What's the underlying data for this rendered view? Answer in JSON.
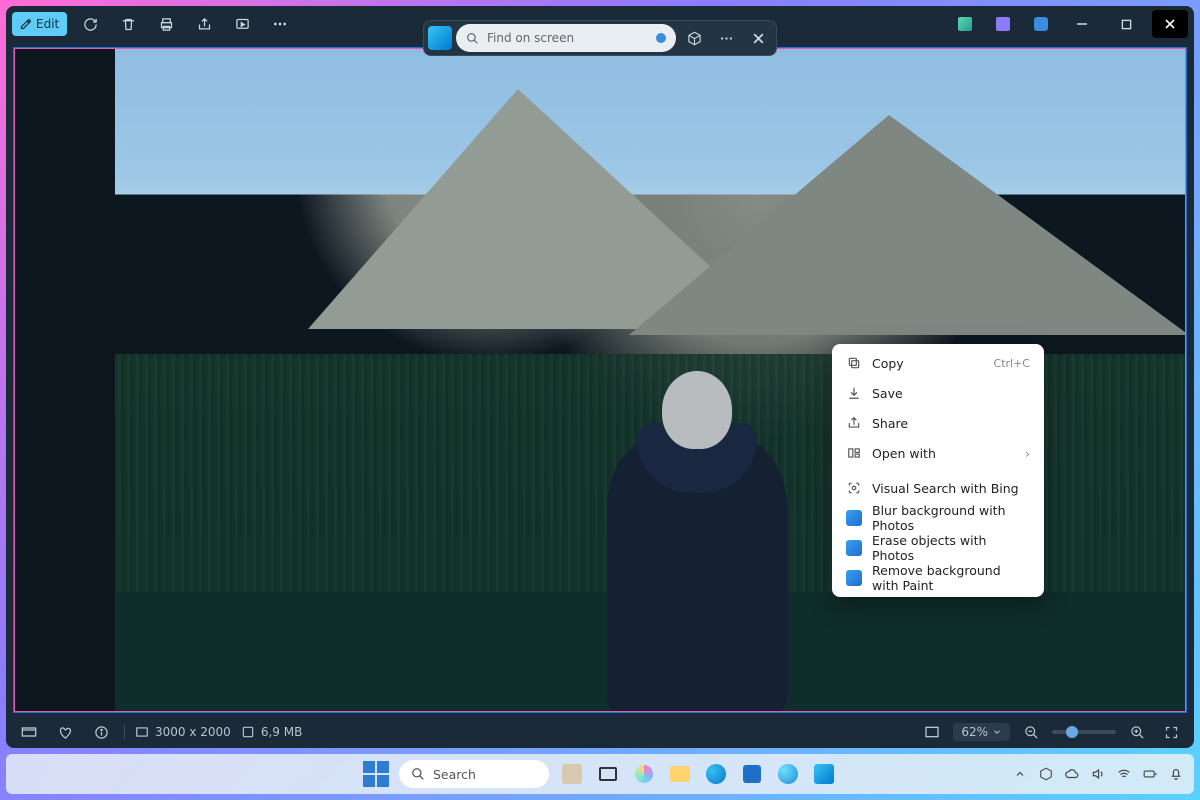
{
  "toolbar": {
    "edit_label": "Edit"
  },
  "search": {
    "placeholder": "Find on screen"
  },
  "context_menu": {
    "items": [
      {
        "label": "Copy",
        "accel": "Ctrl+C",
        "iconKind": "copy"
      },
      {
        "label": "Save",
        "iconKind": "download"
      },
      {
        "label": "Share",
        "iconKind": "share"
      },
      {
        "label": "Open with",
        "iconKind": "openwith",
        "submenu": true
      },
      {
        "label": "Visual Search with Bing",
        "iconKind": "lens"
      },
      {
        "label": "Blur background with Photos",
        "iconKind": "app"
      },
      {
        "label": "Erase objects with Photos",
        "iconKind": "app"
      },
      {
        "label": "Remove background with Paint",
        "iconKind": "app"
      }
    ]
  },
  "status": {
    "dimensions": "3000 x 2000",
    "filesize": "6,9 MB",
    "zoom_label": "62%"
  },
  "taskbar": {
    "search_placeholder": "Search"
  }
}
